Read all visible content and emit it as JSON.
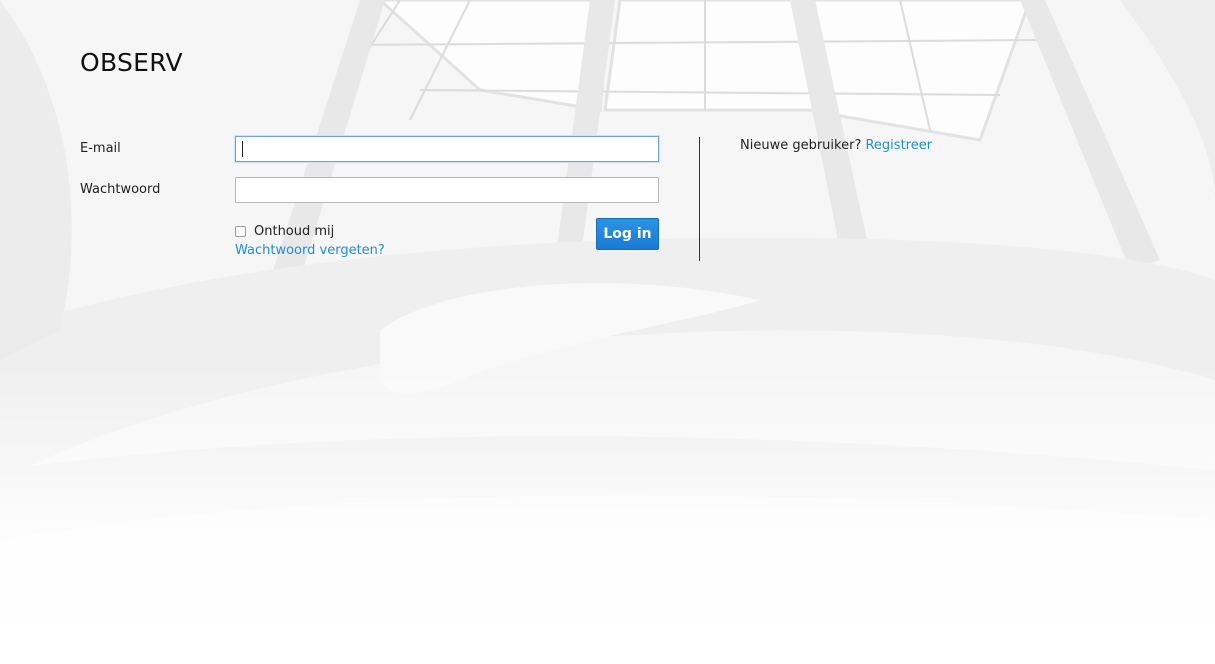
{
  "app": {
    "title": "OBSERV"
  },
  "login": {
    "email_label": "E-mail",
    "email_value": "",
    "password_label": "Wachtwoord",
    "password_value": "",
    "remember_label": "Onthoud mij",
    "remember_checked": false,
    "forgot_link": "Wachtwoord vergeten?",
    "submit_label": "Log in"
  },
  "register": {
    "prompt": "Nieuwe gebruiker?",
    "link": "Registreer"
  },
  "colors": {
    "accent": "#1d8fd0",
    "button": "#1b7ad4",
    "text": "#222222"
  }
}
